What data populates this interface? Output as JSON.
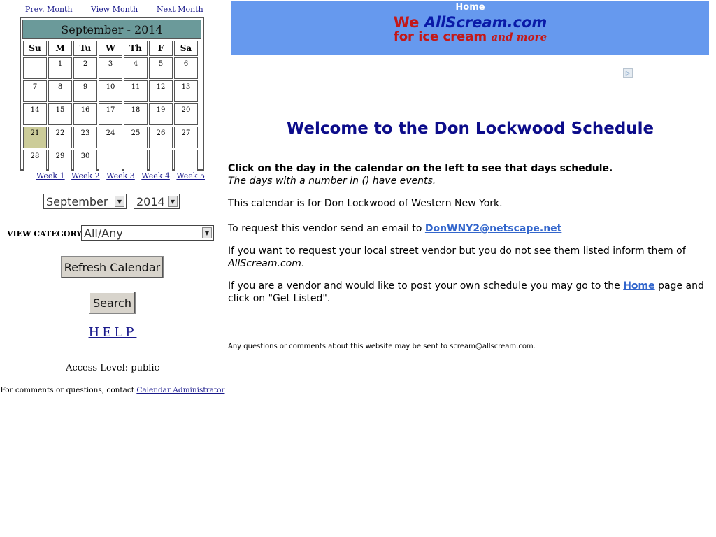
{
  "nav": {
    "prev": "Prev. Month",
    "view": "View Month",
    "next": "Next Month"
  },
  "calendar": {
    "title": "September - 2014",
    "dows": [
      "Su",
      "M",
      "Tu",
      "W",
      "Th",
      "F",
      "Sa"
    ],
    "weeks": [
      [
        "",
        "1",
        "2",
        "3",
        "4",
        "5",
        "6"
      ],
      [
        "7",
        "8",
        "9",
        "10",
        "11",
        "12",
        "13"
      ],
      [
        "14",
        "15",
        "16",
        "17",
        "18",
        "19",
        "20"
      ],
      [
        "21",
        "22",
        "23",
        "24",
        "25",
        "26",
        "27"
      ],
      [
        "28",
        "29",
        "30",
        "",
        "",
        "",
        ""
      ]
    ],
    "today": "21",
    "today_color": "#cccc99"
  },
  "week_links": [
    "Week 1",
    "Week 2",
    "Week 3",
    "Week 4",
    "Week 5"
  ],
  "selects": {
    "month": "September",
    "year": "2014",
    "category_label": "VIEW CATEGORY:",
    "category": "All/Any"
  },
  "buttons": {
    "refresh": "Refresh Calendar",
    "search": "Search"
  },
  "help": "HELP",
  "access": "Access Level: public",
  "contact": {
    "prefix": "For comments or questions, contact ",
    "link": "Calendar Administrator"
  },
  "banner": {
    "home": "Home",
    "we": "We",
    "site": "AllScream.com",
    "tagline": "for ice cream ",
    "and_more": "and more"
  },
  "main": {
    "title": "Welcome to the Don Lockwood Schedule",
    "p1_bold": "Click on the day in the calendar on the left to see that days schedule.",
    "p1_italic": "The days with a number in () have events.",
    "p2": "This calendar is for Don Lockwood of Western New York.",
    "p3_prefix": "To request this vendor send an email to ",
    "p3_email": "DonWNY2@netscape.net",
    "p4_prefix": "If you want to request your local street vendor but you do not see them listed inform them of ",
    "p4_site": "AllScream.com",
    "p4_suffix": ".",
    "p5_prefix": "If you are a vendor and would like to post your own schedule you may go to the ",
    "p5_link": "Home",
    "p5_suffix": " page and click on \"Get Listed\".",
    "footer": "Any questions or comments about this website may be sent to scream@allscream.com."
  },
  "colors": {
    "banner_bg": "#6699ee",
    "calendar_header": "#6b9a9a",
    "title": "#0c0c8a"
  }
}
